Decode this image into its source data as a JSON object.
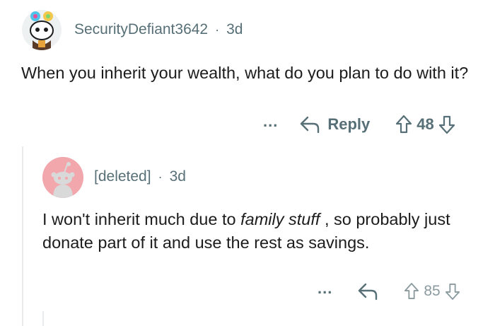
{
  "comments": [
    {
      "username": "SecurityDefiant3642",
      "separator": "·",
      "age": "3d",
      "body": "When you inherit your wealth, what do you plan to do with it?",
      "more_label": "...",
      "reply_label": "Reply",
      "score": "48",
      "icons": {
        "avatar": "snoo-avatar-icon",
        "reply": "reply-arrow-icon",
        "upvote": "upvote-arrow-icon",
        "downvote": "downvote-arrow-icon"
      }
    },
    {
      "username": "[deleted]",
      "separator": "·",
      "age": "3d",
      "body_pre": "I won't inherit much due to ",
      "body_em": "family stuff",
      "body_post": " , so probably just donate part of it and use the rest as savings.",
      "more_label": "...",
      "score": "85",
      "icons": {
        "avatar": "deleted-user-avatar-icon",
        "reply": "reply-arrow-icon",
        "upvote": "upvote-arrow-icon",
        "downvote": "downvote-arrow-icon"
      }
    }
  ],
  "colors": {
    "meta": "#576f76",
    "text": "#1c1c1c",
    "deleted_avatar_bg": "#f2a7ad",
    "thread_line": "#e9ecee"
  }
}
